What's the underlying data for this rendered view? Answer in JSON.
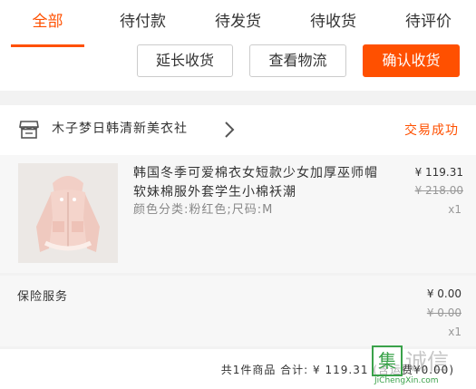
{
  "tabs": [
    {
      "label": "全部",
      "active": true
    },
    {
      "label": "待付款"
    },
    {
      "label": "待发货"
    },
    {
      "label": "待收货"
    },
    {
      "label": "待评价"
    }
  ],
  "actions": {
    "extend": "延长收货",
    "logistics": "查看物流",
    "confirm": "确认收货"
  },
  "order": {
    "shop_name": "木子梦日韩清新美衣社",
    "status": "交易成功",
    "item": {
      "title": "韩国冬季可爱棉衣女短款少女加厚巫师帽软妹棉服外套学生小棉袄潮",
      "sku": "颜色分类:粉红色;尺码:M",
      "price": "¥ 119.31",
      "original_price": "¥ 218.00",
      "quantity": "x1"
    },
    "service": {
      "label": "保险服务",
      "price": "¥ 0.00",
      "original_price": "¥ 0.00",
      "quantity": "x1"
    },
    "summary": "共1件商品 合计: ¥ 119.31 (含运费¥0.00)"
  },
  "watermark": {
    "mark": "集",
    "text": "诚信",
    "url": "JiChengXin.com"
  },
  "colors": {
    "accent": "#ff5000",
    "watermark_green": "#3aa24a"
  },
  "icons": [
    "shop-icon",
    "chevron-right-icon"
  ]
}
